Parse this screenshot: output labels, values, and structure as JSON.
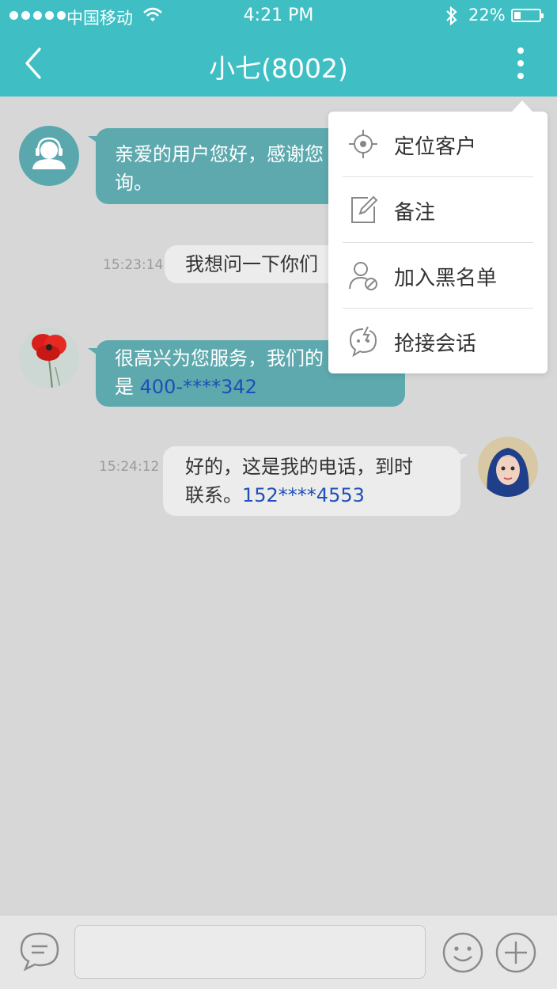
{
  "status_bar": {
    "carrier": "中国移动",
    "time": "4:21 PM",
    "battery_percent": "22%",
    "battery_level": 0.22,
    "icons": [
      "signal-dots-icon",
      "wifi-icon",
      "bluetooth-icon",
      "battery-icon"
    ]
  },
  "navbar": {
    "title": "小七(8002)",
    "back_icon": "chevron-left-icon",
    "more_icon": "more-vertical-icon"
  },
  "messages": [
    {
      "side": "left",
      "avatar": "support-agent-avatar",
      "lines": [
        "亲爱的用户您好，感谢您",
        "询。"
      ]
    },
    {
      "side": "center",
      "timestamp": "15:23:14",
      "text": "我想问一下你们"
    },
    {
      "side": "left",
      "avatar": "poppy-flower-avatar",
      "line1": "很高兴为您服务，我们的",
      "line2_prefix": "是 ",
      "phone": "400-****342"
    },
    {
      "side": "right",
      "timestamp": "15:24:12",
      "avatar": "user-girl-avatar",
      "line1": "好的，这是我的电话，到时",
      "line2_prefix": "联系。",
      "phone": "152****4553"
    }
  ],
  "menu": {
    "items": [
      {
        "label": "定位客户",
        "icon": "locate-crosshair-icon"
      },
      {
        "label": "备注",
        "icon": "edit-note-icon"
      },
      {
        "label": "加入黑名单",
        "icon": "block-user-icon"
      },
      {
        "label": "抢接会话",
        "icon": "grab-chat-icon"
      }
    ]
  },
  "input_bar": {
    "placeholder": "",
    "left_icon": "chat-bubble-icon",
    "emoji_icon": "smiley-icon",
    "plus_icon": "plus-circle-icon"
  },
  "colors": {
    "accent": "#3fbfc4",
    "bubble_teal": "#5ea9ae",
    "background": "#d7d7d7",
    "link": "#1f4fb8"
  }
}
